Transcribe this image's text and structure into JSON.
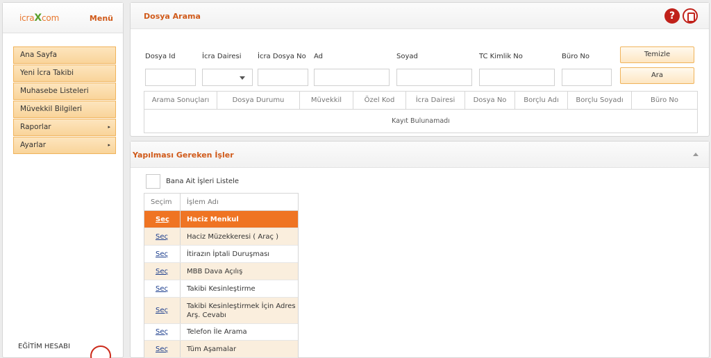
{
  "sidebar": {
    "logo": {
      "pre": "icra",
      "x": "X",
      "post": "com"
    },
    "menu_label": "Menü",
    "items": [
      {
        "label": "Ana Sayfa",
        "arrow": ""
      },
      {
        "label": "Yeni İcra Takibi",
        "arrow": ""
      },
      {
        "label": "Muhasebe Listeleri",
        "arrow": ""
      },
      {
        "label": "Müvekkil Bilgileri",
        "arrow": ""
      },
      {
        "label": "Raporlar",
        "arrow": "▸"
      },
      {
        "label": "Ayarlar",
        "arrow": "▸"
      }
    ],
    "footer": "EĞİTİM HESABI"
  },
  "search": {
    "title": "Dosya Arama",
    "help_glyph": "?",
    "labels": {
      "dosya_id": "Dosya Id",
      "icra_dairesi": "İcra Dairesi",
      "icra_dosya_no": "İcra Dosya No",
      "ad": "Ad",
      "soyad": "Soyad",
      "tc_kimlik_no": "TC Kimlik No",
      "buro_no": "Büro No"
    },
    "clear_label": "Temizle",
    "search_label": "Ara",
    "result_columns": [
      "Arama Sonuçları",
      "Dosya Durumu",
      "Müvekkil",
      "Özel Kod",
      "İcra Dairesi",
      "Dosya No",
      "Borçlu Adı",
      "Borçlu Soyadı",
      "Büro No"
    ],
    "empty_text": "Kayıt Bulunamadı"
  },
  "tasks": {
    "title": "Yapılması Gereken İşler",
    "checkbox_label": "Bana Ait İşleri Listele",
    "col_select": "Seçim",
    "col_name": "İşlem Adı",
    "rows": [
      {
        "select": "Seç",
        "name": "Haciz Menkul"
      },
      {
        "select": "Seç",
        "name": "Haciz Müzekkeresi ( Araç )"
      },
      {
        "select": "Seç",
        "name": "İtirazın İptali Duruşması"
      },
      {
        "select": "Seç",
        "name": "MBB Dava Açılış"
      },
      {
        "select": "Seç",
        "name": "Takibi Kesinleştirme"
      },
      {
        "select": "Seç",
        "name": "Takibi Kesinleştirmek İçin Adres Arş. Cevabı"
      },
      {
        "select": "Seç",
        "name": "Telefon İle Arama"
      },
      {
        "select": "Seç",
        "name": "Tüm Aşamalar"
      }
    ]
  },
  "colors": {
    "accent": "#d05a1a",
    "active_row": "#ef7423",
    "menu_bg": "#f9d49a",
    "help_red": "#c0211a"
  }
}
